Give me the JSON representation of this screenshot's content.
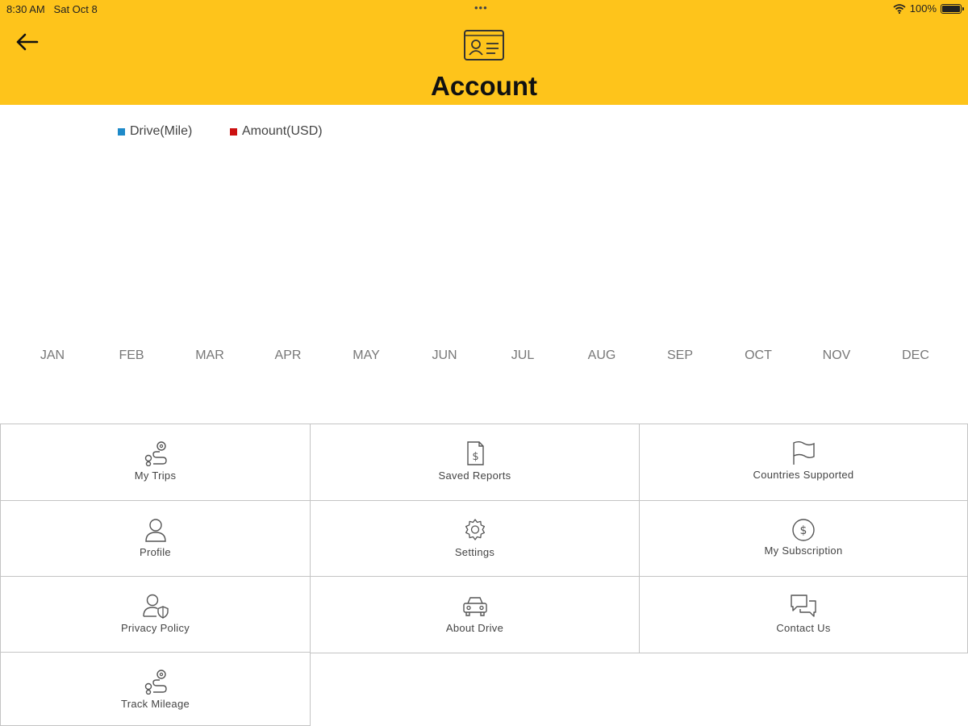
{
  "status_bar": {
    "time": "8:30 AM",
    "date": "Sat Oct 8",
    "multitask_dots": "•••",
    "battery": "100%",
    "icons": [
      "wifi-icon",
      "battery-icon"
    ]
  },
  "header": {
    "title": "Account",
    "back_icon": "back-arrow-icon",
    "title_icon": "id-card-icon",
    "background_color": "#fec41b"
  },
  "chart_data": {
    "type": "bar",
    "title": "",
    "xlabel": "",
    "ylabel": "",
    "categories": [
      "JAN",
      "FEB",
      "MAR",
      "APR",
      "MAY",
      "JUN",
      "JUL",
      "AUG",
      "SEP",
      "OCT",
      "NOV",
      "DEC"
    ],
    "series": [
      {
        "name": "Drive(Mile)",
        "color": "#1e8ac9",
        "values": [
          0,
          0,
          0,
          0,
          0,
          0,
          0,
          0,
          0,
          0,
          0,
          0
        ]
      },
      {
        "name": "Amount(USD)",
        "color": "#cc1111",
        "values": [
          0,
          0,
          0,
          0,
          0,
          0,
          0,
          0,
          0,
          0,
          0,
          0
        ]
      }
    ],
    "legend_position": "top-left",
    "grid": false
  },
  "menu": {
    "items": [
      {
        "label": "My Trips",
        "icon": "route-icon"
      },
      {
        "label": "Saved Reports",
        "icon": "receipt-dollar-icon"
      },
      {
        "label": "Countries Supported",
        "icon": "flag-icon"
      },
      {
        "label": "Profile",
        "icon": "person-icon"
      },
      {
        "label": "Settings",
        "icon": "gear-icon"
      },
      {
        "label": "My Subscription",
        "icon": "dollar-circle-icon"
      },
      {
        "label": "Privacy Policy",
        "icon": "user-shield-icon"
      },
      {
        "label": "About Drive",
        "icon": "car-icon"
      },
      {
        "label": "Contact Us",
        "icon": "chat-bubbles-icon"
      },
      {
        "label": "Track Mileage",
        "icon": "route-icon"
      }
    ]
  }
}
